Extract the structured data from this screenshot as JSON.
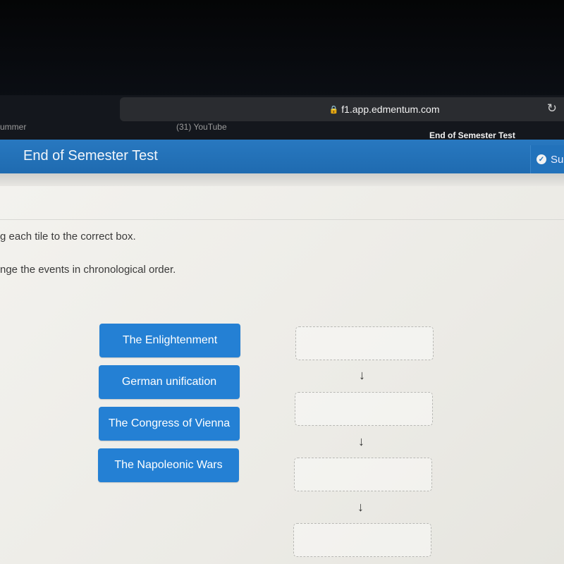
{
  "browser": {
    "url": "f1.app.edmentum.com",
    "lock_icon": "lock-icon",
    "reload_icon": "reload-icon",
    "tabs": [
      {
        "label": "ummer"
      },
      {
        "label": "(31) YouTube"
      },
      {
        "label": "End of Semester Test",
        "active": true
      }
    ]
  },
  "app": {
    "title": "End of Semester Test",
    "submit_label": "Su",
    "accent_color": "#2480d4"
  },
  "question": {
    "instruction_1": "g each tile to the correct box.",
    "instruction_2": "nge the events in chronological order."
  },
  "tiles": [
    {
      "label": "The Enlightenment"
    },
    {
      "label": "German unification"
    },
    {
      "label": "The Congress of Vienna"
    },
    {
      "label": "The Napoleonic Wars"
    }
  ],
  "drop_boxes": [
    {
      "value": ""
    },
    {
      "value": ""
    },
    {
      "value": ""
    },
    {
      "value": ""
    }
  ],
  "arrow_glyph": "↓"
}
